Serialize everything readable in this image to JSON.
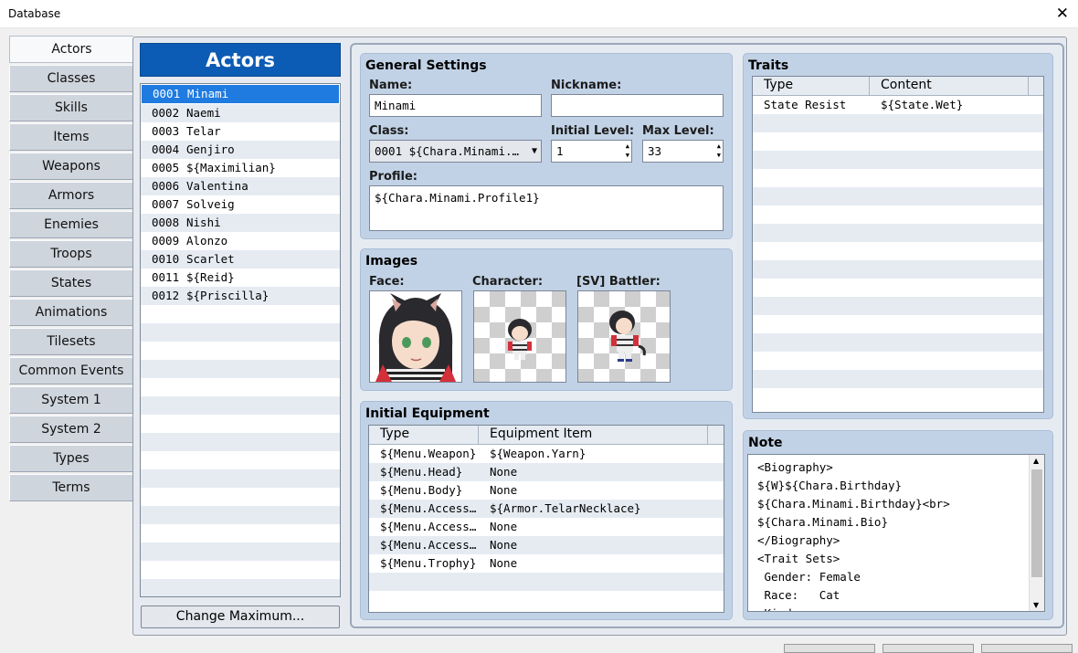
{
  "window": {
    "title": "Database",
    "close_glyph": "✕"
  },
  "nav": [
    "Actors",
    "Classes",
    "Skills",
    "Items",
    "Weapons",
    "Armors",
    "Enemies",
    "Troops",
    "States",
    "Animations",
    "Tilesets",
    "Common Events",
    "System 1",
    "System 2",
    "Types",
    "Terms"
  ],
  "actors_header": "Actors",
  "actors": [
    {
      "id": "0001",
      "name": "Minami"
    },
    {
      "id": "0002",
      "name": "Naemi"
    },
    {
      "id": "0003",
      "name": "Telar"
    },
    {
      "id": "0004",
      "name": "Genjiro"
    },
    {
      "id": "0005",
      "name": "${Maximilian}"
    },
    {
      "id": "0006",
      "name": "Valentina"
    },
    {
      "id": "0007",
      "name": "Solveig"
    },
    {
      "id": "0008",
      "name": "Nishi"
    },
    {
      "id": "0009",
      "name": "Alonzo"
    },
    {
      "id": "0010",
      "name": "Scarlet"
    },
    {
      "id": "0011",
      "name": "${Reid}"
    },
    {
      "id": "0012",
      "name": "${Priscilla}"
    }
  ],
  "change_max_label": "Change Maximum...",
  "general": {
    "title": "General Settings",
    "name_label": "Name:",
    "name_value": "Minami",
    "nickname_label": "Nickname:",
    "nickname_value": "",
    "class_label": "Class:",
    "class_value": "0001 ${Chara.Minami.…",
    "initial_level_label": "Initial Level:",
    "initial_level_value": "1",
    "max_level_label": "Max Level:",
    "max_level_value": "33",
    "profile_label": "Profile:",
    "profile_value": "${Chara.Minami.Profile1}"
  },
  "images": {
    "title": "Images",
    "face_label": "Face:",
    "character_label": "Character:",
    "battler_label": "[SV] Battler:"
  },
  "equipment": {
    "title": "Initial Equipment",
    "col_type": "Type",
    "col_item": "Equipment Item",
    "rows": [
      {
        "type": "${Menu.Weapon}",
        "item": "${Weapon.Yarn}"
      },
      {
        "type": "${Menu.Head}",
        "item": "None"
      },
      {
        "type": "${Menu.Body}",
        "item": "None"
      },
      {
        "type": "${Menu.Access…",
        "item": "${Armor.TelarNecklace}"
      },
      {
        "type": "${Menu.Access…",
        "item": "None"
      },
      {
        "type": "${Menu.Access…",
        "item": "None"
      },
      {
        "type": "${Menu.Trophy}",
        "item": "None"
      }
    ]
  },
  "traits": {
    "title": "Traits",
    "col_type": "Type",
    "col_content": "Content",
    "rows": [
      {
        "type": "State Resist",
        "content": "${State.Wet}"
      }
    ]
  },
  "note": {
    "title": "Note",
    "text": "<Biography>\n${W}${Chara.Birthday}\n${Chara.Minami.Birthday}<br>\n${Chara.Minami.Bio}\n</Biography>\n<Trait Sets>\n Gender: Female\n Race:   Cat\n Kind:"
  }
}
